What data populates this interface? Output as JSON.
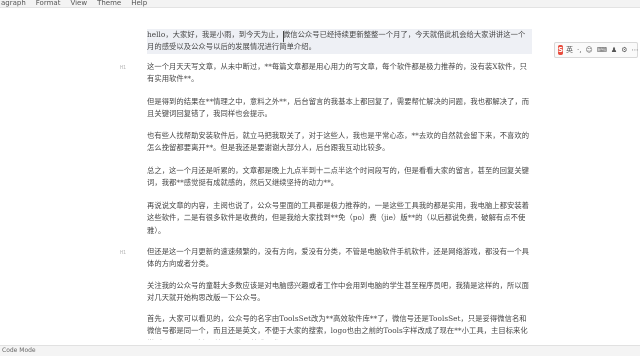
{
  "menubar": {
    "items": [
      "agraph",
      "Format",
      "View",
      "Theme",
      "Help"
    ]
  },
  "editor": {
    "paragraphs": [
      {
        "gutter": "",
        "text": "hello，大家好，我是小雨，到今天为止，微信公众号已经持续更新整整一个月了，今天就借此机会给大家讲讲这一个月的感受以及公众号以后的发展情况进行简单介绍。"
      },
      {
        "gutter": "H1",
        "text": "这一个月天天写文章，从未中断过，**每篇文章都是用心用力的写文章，每个软件都是极力推荐的，没有装X软件，只有实用软件**。"
      },
      {
        "gutter": "",
        "text": "但是得到的结果在**情理之中，意料之外**，后台留言的我基本上都回复了，需要帮忙解决的问题，我也都解决了，而且关键词回复错了，我同样也会提示。"
      },
      {
        "gutter": "",
        "text": "也有些人找帮助安装软件后，就立马把我取关了，对于这些人，我也是平常心态，**去欢的自然就会留下来，不喜欢的怎么挽留都要离开**。但是我还是要谢谢大部分人，后台跟我互动比较多。"
      },
      {
        "gutter": "",
        "text": "总之，这一个月还是听累的，文章都是晚上九点半到十二点半这个时间段写的，但是看看大家的留言，甚至的回复关键词，我都**感觉挺有成就感的，然后又继续坚持的动力**。"
      },
      {
        "gutter": "",
        "text": "再说说文章的内容，主阅也说了，公众号里面的工具都是极力推荐的，一是这些工具我的都是实用，我电脑上都安装着这些软件，二是有很多软件是收费的，但是我给大家找到**免（po）费（jie）版**的（以后都说免费，破解有点不使雅）。"
      },
      {
        "gutter": "H1",
        "text": "但还是这一个月更新的速速频繁的，没有方向，爱没有分类，不管是电脑软件手机软件，还是网络游戏，都没有一个具体的方向或者分类。"
      },
      {
        "gutter": "",
        "text": "关注我的公众号的童鞋大多数应该是对电脑感兴趣或者工作中会用到电脑的学生甚至程序员吧，我猜是这样的，所以面对几天就开始构思改版一下公众号。"
      },
      {
        "gutter": "",
        "text": "首先，大家可以看见的，公众号的名字由ToolsSet改为**高效软件库**了，微信号还是ToolsSet，只是妥得微信名和微信号都是同一个，而且还是英文，不便于大家的搜索，logo也由之前的Tools字样改成了现在**小工具，主目标来化学（Tools以下文），并而下来**技术工作**。"
      }
    ]
  },
  "ime": {
    "logo": "S",
    "items": [
      "英",
      "·,",
      "☺",
      "⌨",
      "♟",
      "⚙",
      "⋯"
    ]
  },
  "status": {
    "mode": "Code Mode"
  }
}
